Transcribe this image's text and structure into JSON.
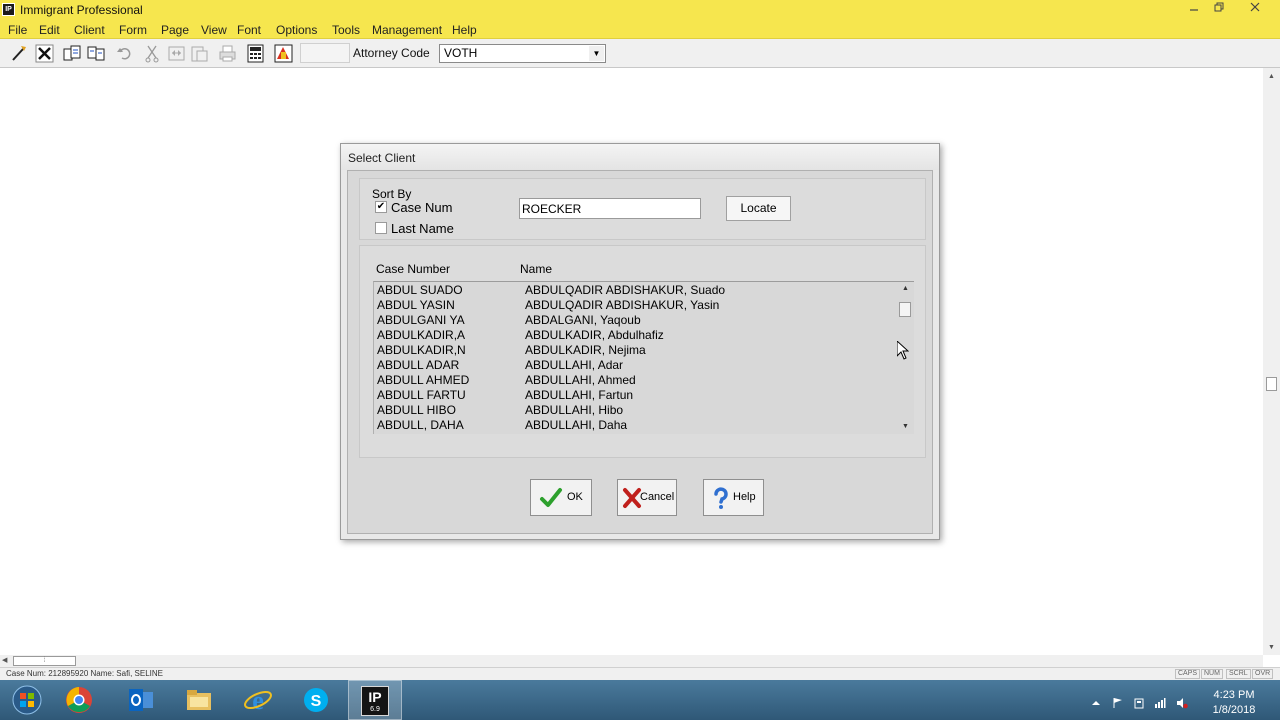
{
  "window": {
    "title": "Immigrant Professional",
    "app_icon_text": "IP",
    "controls": [
      "minimize",
      "restore",
      "close"
    ]
  },
  "menu": [
    "File",
    "Edit",
    "Client",
    "Form",
    "Page",
    "View",
    "Font",
    "Options",
    "Tools",
    "Management",
    "Help"
  ],
  "toolbar": {
    "attorney_label": "Attorney Code",
    "attorney_value": "VOTH"
  },
  "dialog": {
    "title": "Select Client",
    "sort_by_label": "Sort By",
    "options": [
      {
        "label": "Case Num",
        "checked": true,
        "check_glyph": "✔"
      },
      {
        "label": "Last Name",
        "checked": false,
        "check_glyph": ""
      }
    ],
    "locate_value": "ROECKER",
    "locate_button": "Locate",
    "columns": {
      "case": "Case Number",
      "name": "Name"
    },
    "rows": [
      {
        "case": "ABDUL SUADO",
        "name": "ABDULQADIR ABDISHAKUR, Suado"
      },
      {
        "case": "ABDUL YASIN",
        "name": "ABDULQADIR ABDISHAKUR, Yasin"
      },
      {
        "case": "ABDULGANI YA",
        "name": "ABDALGANI, Yaqoub"
      },
      {
        "case": "ABDULKADIR,A",
        "name": "ABDULKADIR, Abdulhafiz"
      },
      {
        "case": "ABDULKADIR,N",
        "name": "ABDULKADIR, Nejima"
      },
      {
        "case": "ABDULL ADAR",
        "name": "ABDULLAHI, Adar"
      },
      {
        "case": "ABDULL AHMED",
        "name": "ABDULLAHI, Ahmed"
      },
      {
        "case": "ABDULL FARTU",
        "name": "ABDULLAHI, Fartun"
      },
      {
        "case": "ABDULL HIBO",
        "name": "ABDULLAHI, Hibo"
      },
      {
        "case": "ABDULL, DAHA",
        "name": "ABDULLAHI, Daha"
      }
    ],
    "buttons": {
      "ok": "OK",
      "cancel": "Cancel",
      "help": "Help"
    }
  },
  "statusbar": {
    "left_text": "Case Num: 212895920  Name: Safi, SELINE",
    "indicators": [
      "CAPS",
      "NUM",
      "SCRL",
      "OVR"
    ]
  },
  "taskbar": {
    "ip_label": "IP",
    "ip_version": "6.9",
    "time": "4:23 PM",
    "date": "1/8/2018"
  },
  "colors": {
    "titlebar": "#f6e64e",
    "dialog_body": "#d8d8d8",
    "ok_check": "#2da02d",
    "cancel_x": "#c0201c",
    "help_q": "#2f6fd0",
    "taskbar": "#3a6686"
  }
}
